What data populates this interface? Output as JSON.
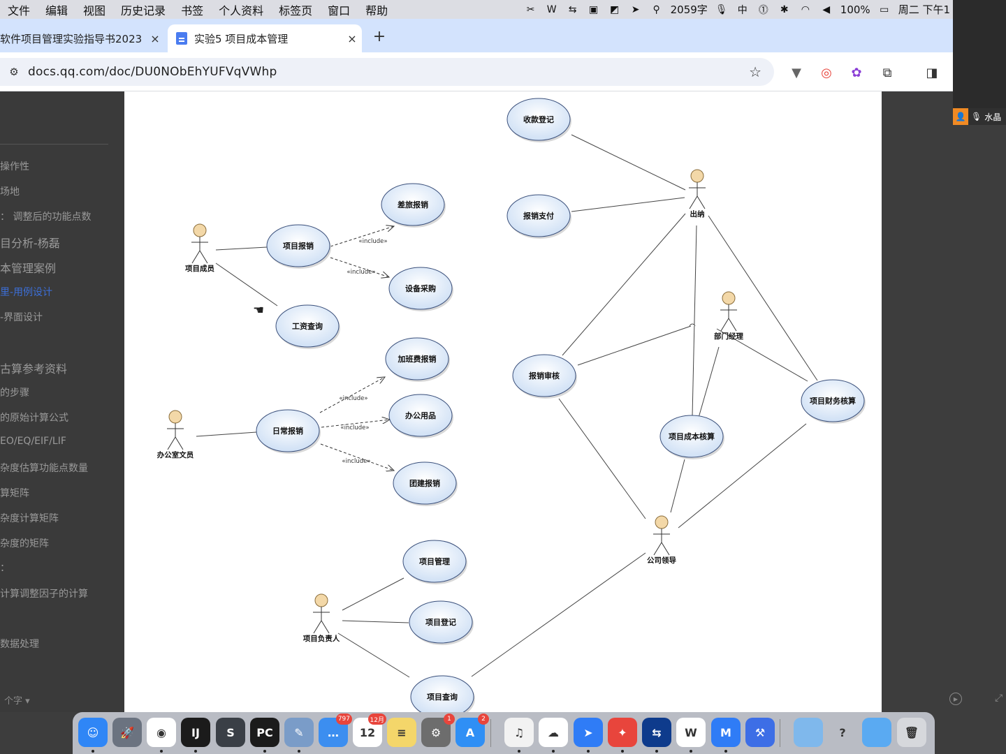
{
  "menubar": {
    "apple": "",
    "items": [
      "文件",
      "编辑",
      "视图",
      "历史记录",
      "书签",
      "个人资料",
      "标签页",
      "窗口",
      "帮助"
    ],
    "word_count": "2059字",
    "input_method": "中",
    "battery": "100%",
    "clock": "周二 下午1"
  },
  "browser": {
    "tabs": [
      {
        "title": "软件项目管理实验指导书2023",
        "active": false
      },
      {
        "title": "实验5 项目成本管理",
        "active": true
      }
    ],
    "url": "docs.qq.com/doc/DU0NObEhYUFVqVWhp",
    "new_tab": "+",
    "close": "×"
  },
  "meeting": {
    "name": "水晶"
  },
  "sidebar": {
    "items": [
      {
        "text": "操作性",
        "big": false,
        "active": false
      },
      {
        "text": "场地",
        "big": false,
        "active": false
      },
      {
        "text": "：  调整后的功能点数",
        "big": false,
        "active": false
      },
      {
        "text": "目分析-杨磊",
        "big": true,
        "active": false
      },
      {
        "text": "本管理案例",
        "big": true,
        "active": false
      },
      {
        "text": "里-用例设计",
        "big": false,
        "active": true
      },
      {
        "text": "-界面设计",
        "big": false,
        "active": false
      },
      {
        "text": "古算参考资料",
        "big": true,
        "active": false
      },
      {
        "text": "的步骤",
        "big": false,
        "active": false
      },
      {
        "text": "的原始计算公式",
        "big": false,
        "active": false
      },
      {
        "text": "EO/EQ/EIF/LIF",
        "big": false,
        "active": false
      },
      {
        "text": "杂度估算功能点数量",
        "big": false,
        "active": false
      },
      {
        "text": "算矩阵",
        "big": false,
        "active": false
      },
      {
        "text": "杂度计算矩阵",
        "big": false,
        "active": false
      },
      {
        "text": "杂度的矩阵",
        "big": false,
        "active": false
      },
      {
        "text": "：",
        "big": false,
        "active": false
      },
      {
        "text": "计算调整因子的计算",
        "big": false,
        "active": false
      },
      {
        "text": "数据处理",
        "big": false,
        "active": false
      }
    ],
    "word_count_label": "个字 ▾"
  },
  "diagram": {
    "actors": [
      {
        "id": "member",
        "label": "项目成员"
      },
      {
        "id": "clerk",
        "label": "办公室文员"
      },
      {
        "id": "pm",
        "label": "项目负责人"
      },
      {
        "id": "cashier",
        "label": "出纳"
      },
      {
        "id": "deptmgr",
        "label": "部门经理"
      },
      {
        "id": "leader",
        "label": "公司领导"
      }
    ],
    "use_cases": [
      {
        "id": "collect",
        "label": "收款登记"
      },
      {
        "id": "pay",
        "label": "报销支付"
      },
      {
        "id": "travel",
        "label": "差旅报销"
      },
      {
        "id": "proj_reimb",
        "label": "项目报销"
      },
      {
        "id": "equip",
        "label": "设备采购"
      },
      {
        "id": "salary",
        "label": "工资查询"
      },
      {
        "id": "overtime",
        "label": "加班费报销"
      },
      {
        "id": "daily",
        "label": "日常报销"
      },
      {
        "id": "office",
        "label": "办公用品"
      },
      {
        "id": "team",
        "label": "团建报销"
      },
      {
        "id": "audit",
        "label": "报销审核"
      },
      {
        "id": "fin_check",
        "label": "项目财务核算"
      },
      {
        "id": "cost_check",
        "label": "项目成本核算"
      },
      {
        "id": "proj_mgmt",
        "label": "项目管理"
      },
      {
        "id": "proj_reg",
        "label": "项目登记"
      },
      {
        "id": "proj_query",
        "label": "项目查询"
      }
    ],
    "include_label": "«include»"
  },
  "dock": {
    "apps": [
      {
        "name": "finder",
        "label": "☺",
        "color": "#2f86f6"
      },
      {
        "name": "launchpad",
        "label": "🚀",
        "color": "#6b7380"
      },
      {
        "name": "chrome",
        "label": "◉",
        "color": "#ffffff"
      },
      {
        "name": "intellij",
        "label": "IJ",
        "color": "#1b1b1b"
      },
      {
        "name": "sublime",
        "label": "S",
        "color": "#3a3f46"
      },
      {
        "name": "pycharm",
        "label": "PC",
        "color": "#1b1b1b"
      },
      {
        "name": "preview",
        "label": "✎",
        "color": "#7a9cc8"
      },
      {
        "name": "messages",
        "label": "…",
        "color": "#3c8ef0",
        "badge": "797"
      },
      {
        "name": "calendar",
        "label": "12",
        "color": "#ffffff",
        "badge": "12月"
      },
      {
        "name": "notes",
        "label": "≡",
        "color": "#f4d66a"
      },
      {
        "name": "system-settings",
        "label": "⚙",
        "color": "#6d6d6d",
        "badge": "1"
      },
      {
        "name": "app-store",
        "label": "A",
        "color": "#2f8ff5",
        "badge": "2"
      },
      {
        "name": "music",
        "label": "♫",
        "color": "#f2f2f2"
      },
      {
        "name": "baidu-netdisk",
        "label": "☁",
        "color": "#ffffff"
      },
      {
        "name": "feishu",
        "label": "➤",
        "color": "#2f7cf6"
      },
      {
        "name": "acrobat",
        "label": "✦",
        "color": "#e8453c"
      },
      {
        "name": "teamviewer",
        "label": "⇆",
        "color": "#0e3b8c"
      },
      {
        "name": "wps",
        "label": "W",
        "color": "#ffffff"
      },
      {
        "name": "tencent-meeting",
        "label": "M",
        "color": "#2f7cf6"
      },
      {
        "name": "xcode",
        "label": "⚒",
        "color": "#3d6ee6"
      },
      {
        "name": "folder-a",
        "label": "",
        "color": "#7fb8ec"
      },
      {
        "name": "help",
        "label": "?",
        "color": "#b9bcc4"
      },
      {
        "name": "folder-b",
        "label": "",
        "color": "#5aaaf2"
      },
      {
        "name": "trash",
        "label": "🗑",
        "color": "#d6d8dc"
      }
    ]
  }
}
